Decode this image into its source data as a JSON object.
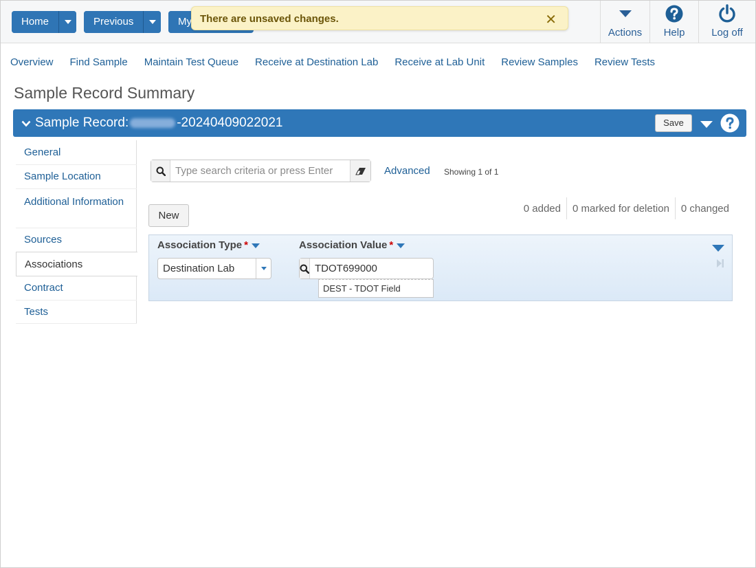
{
  "topbar": {
    "home_label": "Home",
    "previous_label": "Previous",
    "my_label": "My",
    "toast_text": "There are unsaved changes.",
    "toast_close": "✕",
    "actions_label": "Actions",
    "help_label": "Help",
    "logoff_label": "Log off"
  },
  "subnav": [
    "Overview",
    "Find Sample",
    "Maintain Test Queue",
    "Receive at Destination Lab",
    "Receive at Lab Unit",
    "Review Samples",
    "Review Tests"
  ],
  "page_title": "Sample Record Summary",
  "record": {
    "prefix": "Sample Record:",
    "suffix": "-20240409022021",
    "save_label": "Save"
  },
  "sidebar": {
    "items": [
      "General",
      "Sample Location",
      "Additional Information",
      "Sources",
      "Associations",
      "Contract",
      "Tests"
    ],
    "active": "Associations"
  },
  "search": {
    "placeholder": "Type search criteria or press Enter",
    "advanced_label": "Advanced",
    "showing": "Showing 1 of 1"
  },
  "toolbar": {
    "new_label": "New",
    "added": "0 added",
    "marked": "0 marked for deletion",
    "changed": "0 changed"
  },
  "grid": {
    "col_type": "Association Type",
    "col_value": "Association Value",
    "required_mark": "*",
    "row": {
      "type": "Destination Lab",
      "value": "TDOT699000",
      "value_desc": "DEST - TDOT Field"
    }
  },
  "colors": {
    "primary": "#2f77b8",
    "link": "#1e5f96",
    "toast_bg": "#fbf2c7",
    "required": "#cc0000"
  },
  "icons": [
    "chevron-down-icon",
    "question-icon",
    "power-icon",
    "search-icon",
    "eraser-icon",
    "close-icon",
    "last-page-icon"
  ]
}
